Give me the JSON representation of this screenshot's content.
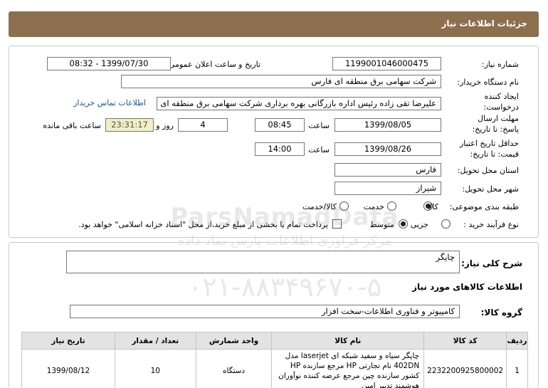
{
  "page": {
    "title": "جزئیات اطلاعات نیاز"
  },
  "need_number": {
    "label": "شماره نیاز:",
    "value": "1199001046000475"
  },
  "announce": {
    "label": "تاریخ و ساعت اعلان عمومی:",
    "value": "1399/07/30 - 08:32"
  },
  "buyer_org": {
    "label": "نام دستگاه خریدار:",
    "value": "شرکت سهامی برق منطقه ای فارس"
  },
  "creator": {
    "label": "ایجاد کننده درخواست:",
    "value": "علیرضا  تقی زاده رئیس اداره بازرگانی بهره برداری شرکت سهامی برق منطقه ای",
    "contact_link": "اطلاعات تماس خریدار"
  },
  "deadline": {
    "label": "مهلت ارسال پاسخ: تا تاریخ:",
    "date": "1399/08/05",
    "time_label": "ساعت",
    "time": "08:45",
    "days": "4",
    "days_label": "روز و",
    "countdown": "23:31:17",
    "remaining_label": "ساعت باقی مانده"
  },
  "validity": {
    "label": "حداقل تاریخ اعتبار قیمت: تا تاریخ:",
    "date": "1399/08/26",
    "time_label": "ساعت",
    "time": "14:00"
  },
  "province": {
    "label": "استان محل تحویل:",
    "value": "فارس"
  },
  "city": {
    "label": "شهر محل تحویل:",
    "value": "شیراز"
  },
  "category": {
    "label": "طبقه بندی موضوعی:",
    "options": [
      "کالا",
      "خدمت",
      "کالا/خدمت"
    ],
    "selected": "کالا"
  },
  "purchase_type": {
    "label": "نوع فرآیند خرید :",
    "options": [
      "جزیی",
      "متوسط"
    ],
    "selected": "متوسط",
    "payment_note": "پرداخت تمام یا بخشی از مبلغ خرید،از محل \"اسناد خزانه اسلامی\" خواهد بود."
  },
  "general_desc": {
    "label": "شرح کلی نیاز:",
    "value": "چاپگر"
  },
  "goods_section": {
    "title": "اطلاعات کالاهای مورد نیاز"
  },
  "goods_group": {
    "label": "گروه کالا:",
    "value": "کامپیوتر و فناوری اطلاعات-سخت افزار"
  },
  "watermark": {
    "line1": "ParsNamadData",
    "line2": "مرکز فراوری اطلاعات پارس نماد داده",
    "line3": "پایگاه اطلاع رسانی مناقصه و مزایده",
    "line4": "۰۲۱-۸۸۳۴۹۶۷۰-۵"
  },
  "table": {
    "headers": {
      "row": "ردیف",
      "code": "کد کالا",
      "name": "نام کالا",
      "unit": "واحد شمارش",
      "qty": "تعداد / مقدار",
      "date": "تاریخ نیاز"
    },
    "rows": [
      {
        "row": "1",
        "code": "2232200925800002",
        "name": "چاپگر سیاه و سفید شبکه ای laserjet مدل 402DN نام تجارتی HP مرجع سازنده HP کشور سازنده چین مرجع عرضه کننده نوآوران هوشمند تدبیر امین",
        "unit": "دستگاه",
        "qty": "10",
        "date": "1399/08/12"
      }
    ]
  }
}
